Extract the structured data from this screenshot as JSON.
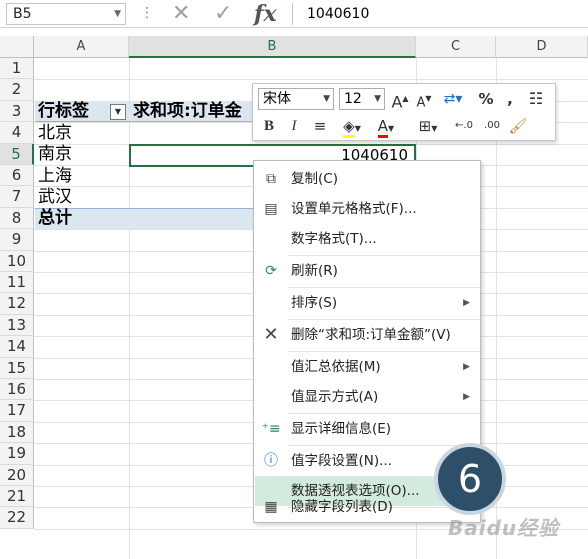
{
  "formula_bar": {
    "cell_ref": "B5",
    "formula_value": "1040610"
  },
  "grid": {
    "columns": [
      "A",
      "B",
      "C",
      "D"
    ],
    "rows": [
      "1",
      "2",
      "3",
      "4",
      "5",
      "6",
      "7",
      "8",
      "9",
      "10",
      "11",
      "12",
      "13",
      "14",
      "15",
      "16",
      "17",
      "18",
      "19",
      "20",
      "21",
      "22"
    ],
    "active_column": "B",
    "active_row": "5"
  },
  "pivot": {
    "row_label_header": "行标签",
    "value_header": "求和项:订单金",
    "rows": [
      "北京",
      "南京",
      "上海",
      "武汉"
    ],
    "total_label": "总计",
    "b5_value": "1040610"
  },
  "mini_toolbar": {
    "font_name": "宋体",
    "font_size": "12",
    "grow_font": "A",
    "shrink_font": "A",
    "percent": "%",
    "comma": ",",
    "bold": "B",
    "italic": "I",
    "font_color_letter": "A",
    "inc_decimal": "←.0",
    "dec_decimal": ".00",
    "accent_green": "#217346"
  },
  "context_menu": {
    "items": [
      {
        "label": "复制(C)",
        "icon": "copy-icon",
        "submenu": false
      },
      {
        "label": "设置单元格格式(F)...",
        "icon": "format-cells-icon",
        "submenu": false
      },
      {
        "label": "数字格式(T)...",
        "icon": "",
        "submenu": false
      },
      {
        "label": "刷新(R)",
        "icon": "refresh-icon",
        "submenu": false
      },
      {
        "label": "排序(S)",
        "icon": "",
        "submenu": true
      },
      {
        "label": "删除“求和项:订单金额”(V)",
        "icon": "delete-icon",
        "submenu": false
      },
      {
        "label": "值汇总依据(M)",
        "icon": "",
        "submenu": true
      },
      {
        "label": "值显示方式(A)",
        "icon": "",
        "submenu": true
      },
      {
        "label": "显示详细信息(E)",
        "icon": "show-details-icon",
        "submenu": false
      },
      {
        "label": "值字段设置(N)...",
        "icon": "field-settings-icon",
        "submenu": false
      },
      {
        "label": "数据透视表选项(O)...",
        "icon": "",
        "submenu": false
      },
      {
        "label": "隐藏字段列表(D)",
        "icon": "field-list-icon",
        "submenu": false
      }
    ],
    "highlight_color": "#d2ebdc"
  },
  "step_badge": "6",
  "watermark": "Baidu经验"
}
